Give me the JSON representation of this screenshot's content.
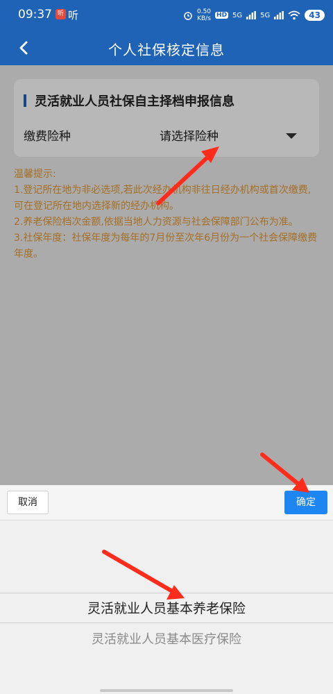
{
  "status_bar": {
    "time": "09:37",
    "notification_badge": "听",
    "notification_text": "听",
    "speed_top": "0.50",
    "speed_bottom": "KB/s",
    "hd_badge": "HD",
    "signal_1": "5G",
    "signal_2": "5G",
    "battery": "43"
  },
  "header": {
    "title": "个人社保核定信息",
    "back_icon": "chevron-left-icon"
  },
  "card": {
    "title": "灵活就业人员社保自主择档申报信息",
    "field_label": "缴费险种",
    "select_placeholder": "请选择险种",
    "accent_color": "#1f63b6"
  },
  "tips": {
    "heading": "温馨提示:",
    "line1": "1.登记所在地为非必选项,若此次经办机构非往日经办机构或首次缴费,可在登记所在地内选择新的经办机构。",
    "line2": "2.养老保险档次金额,依据当地人力资源与社会保障部门公布为准。",
    "line3": "3.社保年度：社保年度为每年的7月份至次年6月份为一个社会保障缴费年度。",
    "color": "#e39a35"
  },
  "picker": {
    "cancel_label": "取消",
    "confirm_label": "确定",
    "options": [
      "灵活就业人员基本养老保险",
      "灵活就业人员基本医疗保险"
    ],
    "confirm_color": "#1d86f0"
  },
  "annotation_color": "#ff2b1b"
}
